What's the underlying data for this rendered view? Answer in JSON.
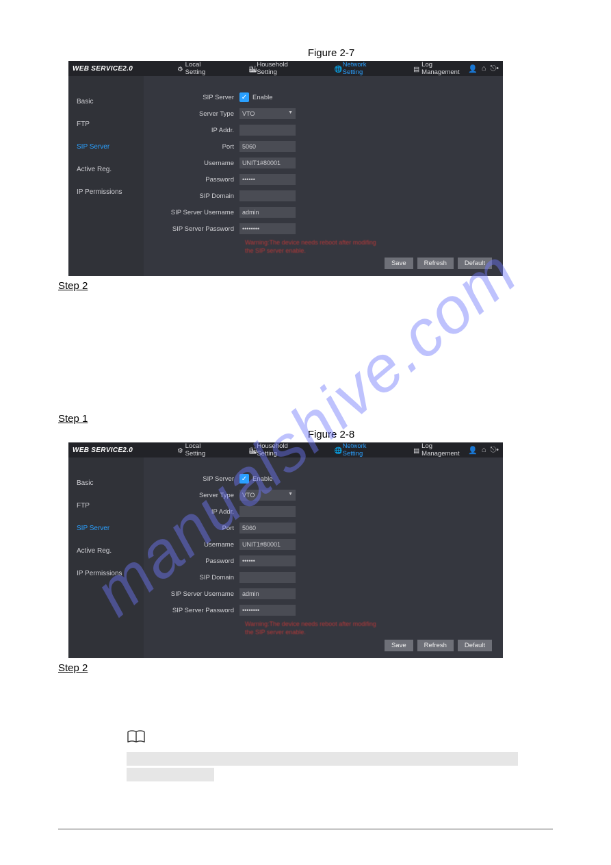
{
  "watermark_text": "manualshive.com",
  "figure_a_caption": "Figure 2-7",
  "figure_b_caption": "Figure 2-8",
  "step1_label": "Step 1",
  "step2_label": "Step 2",
  "shot": {
    "logo": "WEB SERVICE2.0",
    "nav": {
      "local": "Local Setting",
      "household": "Household Setting",
      "network": "Network Setting",
      "log": "Log Management"
    },
    "sidebar": {
      "basic": "Basic",
      "ftp": "FTP",
      "sip": "SIP Server",
      "active": "Active Reg.",
      "ipperm": "IP Permissions"
    },
    "labels": {
      "sip_server": "SIP Server",
      "enable": "Enable",
      "server_type": "Server Type",
      "ip_addr": "IP Addr.",
      "port": "Port",
      "username": "Username",
      "password": "Password",
      "sip_domain": "SIP Domain",
      "sip_user": "SIP Server Username",
      "sip_pass": "SIP Server Password"
    },
    "values": {
      "server_type": "VTO",
      "ip_addr": "",
      "port": "5060",
      "username": "UNIT1#80001",
      "password": "••••••",
      "sip_domain": "",
      "sip_user": "admin",
      "sip_pass": "••••••••"
    },
    "warning": "Warning:The device needs reboot after modifing the SIP server enable.",
    "buttons": {
      "save": "Save",
      "refresh": "Refresh",
      "default": "Default"
    }
  }
}
